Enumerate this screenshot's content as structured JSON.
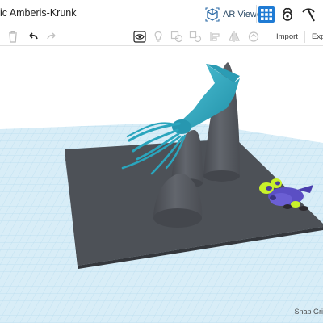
{
  "window": {
    "title": "ic Amberis-Krunk",
    "ar_viewer_label": "AR Viewer"
  },
  "toolbar": {
    "import_label": "Import",
    "export_label": "Expo"
  },
  "viewport": {
    "snap_grid_label": "Snap Gri"
  },
  "icons": {
    "ar": "cube-3d-icon",
    "grid_view": "grid-icon",
    "second": "build-icon",
    "third": "pickaxe-icon",
    "delete": "trash-icon",
    "undo": "undo-icon",
    "redo": "redo-icon",
    "visibility": "eye-icon",
    "light": "lightbulb-icon",
    "group": "group-icon",
    "ungroup": "ungroup-icon",
    "align": "align-icon",
    "mirror": "mirror-icon",
    "cruise": "cruise-icon"
  },
  "colors": {
    "accent": "#1f7bd4",
    "grid_plane": "#d6ecf6",
    "grid_line": "#b5d9ec",
    "workplane": "#4d5157",
    "squid": "#2aa7bf",
    "shape_gray": "#5a5e64"
  }
}
